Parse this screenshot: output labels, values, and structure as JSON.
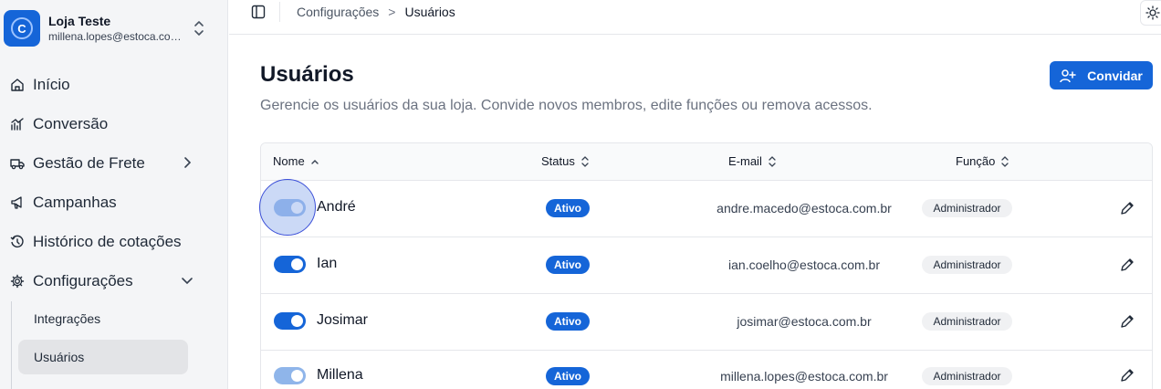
{
  "store": {
    "name": "Loja Teste",
    "email": "millena.lopes@estoca.com.br",
    "logo_letter": "C"
  },
  "nav": {
    "items": [
      {
        "label": "Início",
        "icon": "home-icon"
      },
      {
        "label": "Conversão",
        "icon": "chart-icon"
      },
      {
        "label": "Gestão de Frete",
        "icon": "truck-icon"
      },
      {
        "label": "Campanhas",
        "icon": "megaphone-icon"
      },
      {
        "label": "Histórico de cotações",
        "icon": "history-icon"
      },
      {
        "label": "Configurações",
        "icon": "gear-icon"
      }
    ],
    "sub_items": [
      {
        "label": "Integrações",
        "active": false
      },
      {
        "label": "Usuários",
        "active": true
      }
    ]
  },
  "breadcrumb": {
    "parent": "Configurações",
    "separator": ">",
    "current": "Usuários"
  },
  "page": {
    "title": "Usuários",
    "description": "Gerencie os usuários da sua loja. Convide novos membros, edite funções ou remova acessos.",
    "invite_label": "Convidar"
  },
  "table": {
    "headers": {
      "name": "Nome",
      "status": "Status",
      "email": "E-mail",
      "role": "Função"
    },
    "rows": [
      {
        "name": "André",
        "status": "Ativo",
        "email": "andre.macedo@estoca.com.br",
        "role": "Administrador",
        "enabled": true
      },
      {
        "name": "Ian",
        "status": "Ativo",
        "email": "ian.coelho@estoca.com.br",
        "role": "Administrador",
        "enabled": true
      },
      {
        "name": "Josimar",
        "status": "Ativo",
        "email": "josimar@estoca.com.br",
        "role": "Administrador",
        "enabled": true
      },
      {
        "name": "Millena",
        "status": "Ativo",
        "email": "millena.lopes@estoca.com.br",
        "role": "Administrador",
        "enabled": true
      }
    ]
  },
  "colors": {
    "accent": "#1565d8",
    "sidebar_bg": "#f4f5f7",
    "role_badge_bg": "#f0f1f3"
  }
}
